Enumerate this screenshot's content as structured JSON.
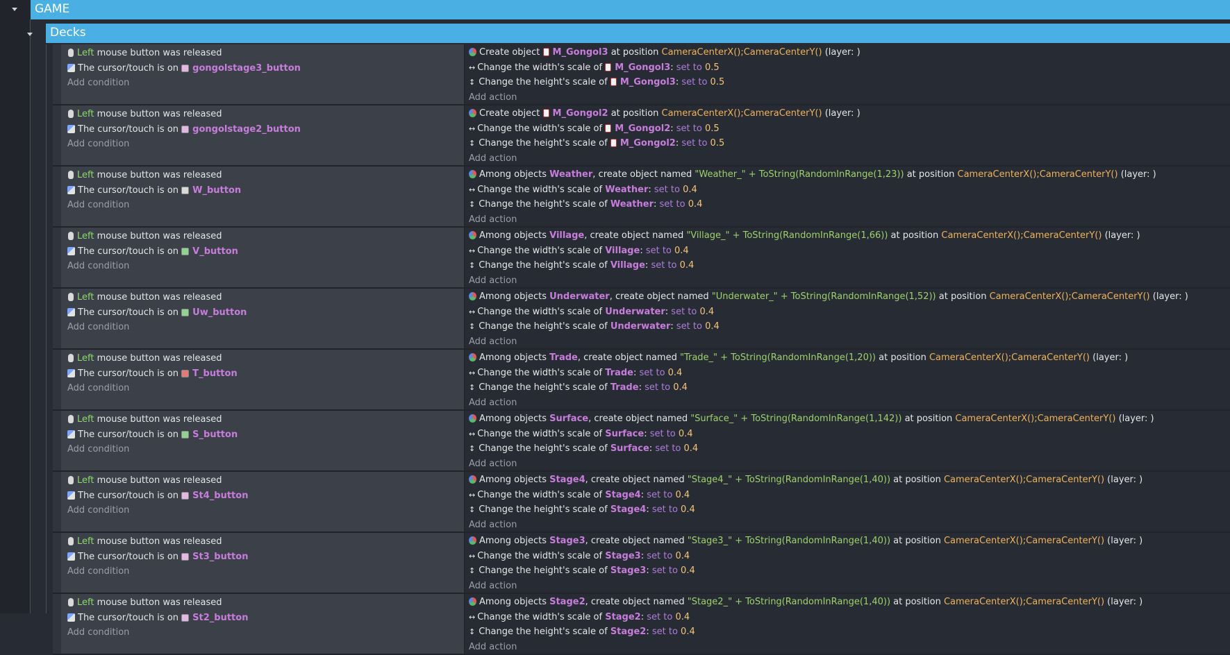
{
  "groups": [
    {
      "title": "GAME"
    },
    {
      "title": "Decks"
    }
  ],
  "labels": {
    "add_condition": "Add condition",
    "add_action": "Add action",
    "left": "Left",
    "mouse_released": " mouse button was released",
    "cursor_on": "The cursor/touch is on ",
    "create_object": "Create object ",
    "among_objects": "Among objects ",
    "create_named": ", create object named ",
    "at_position": " at position ",
    "layer": " (layer: )",
    "width_scale": "Change the width's scale of ",
    "height_scale": "Change the height's scale of ",
    "colon": ": ",
    "set_to": "set to ",
    "camera": "CameraCenterX();CameraCenterY()"
  },
  "events": [
    {
      "button": "gongolstage3_button",
      "button_icon": "pink",
      "kind": "create",
      "object": "M_Gongol3",
      "value": "0.5"
    },
    {
      "button": "gongolstage2_button",
      "button_icon": "pink",
      "kind": "create",
      "object": "M_Gongol2",
      "value": "0.5"
    },
    {
      "button": "W_button",
      "button_icon": "default",
      "kind": "among",
      "object": "Weather",
      "name_expr": "\"Weather_\" + ToString(RandomInRange(1,23))",
      "value": "0.4"
    },
    {
      "button": "V_button",
      "button_icon": "green",
      "kind": "among",
      "object": "Village",
      "name_expr": "\"Village_\" + ToString(RandomInRange(1,66))",
      "value": "0.4"
    },
    {
      "button": "Uw_button",
      "button_icon": "green",
      "kind": "among",
      "object": "Underwater",
      "name_expr": "\"Underwater_\" + ToString(RandomInRange(1,52))",
      "value": "0.4"
    },
    {
      "button": "T_button",
      "button_icon": "red",
      "kind": "among",
      "object": "Trade",
      "name_expr": "\"Trade_\" + ToString(RandomInRange(1,20))",
      "value": "0.4"
    },
    {
      "button": "S_button",
      "button_icon": "green",
      "kind": "among",
      "object": "Surface",
      "name_expr": "\"Surface_\" + ToString(RandomInRange(1,142))",
      "value": "0.4"
    },
    {
      "button": "St4_button",
      "button_icon": "pink",
      "kind": "among",
      "object": "Stage4",
      "name_expr": "\"Stage4_\" + ToString(RandomInRange(1,40))",
      "value": "0.4"
    },
    {
      "button": "St3_button",
      "button_icon": "pink",
      "kind": "among",
      "object": "Stage3",
      "name_expr": "\"Stage3_\" + ToString(RandomInRange(1,40))",
      "value": "0.4"
    },
    {
      "button": "St2_button",
      "button_icon": "pink",
      "kind": "among",
      "object": "Stage2",
      "name_expr": "\"Stage2_\" + ToString(RandomInRange(1,40))",
      "value": "0.4"
    }
  ]
}
